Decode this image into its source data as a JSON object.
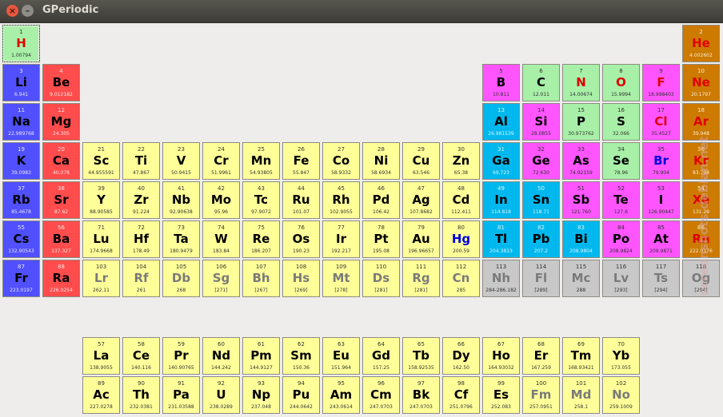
{
  "window": {
    "title": "GPeriodic",
    "close_glyph": "×",
    "minimize_glyph": "–"
  },
  "watermark": "screenshots.debian.net",
  "colors": {
    "h": "#a8f0a8",
    "alkali": "#5050ff",
    "alkaline": "#ff4c4c",
    "transition": "#ffff99",
    "metal": "#00b8ee",
    "metalloid": "#ff55ff",
    "nonmetal": "#a8f0a8",
    "halogen": "#ff55ff",
    "noble": "#cc7a00",
    "lanth": "#ffff99",
    "unknown": "#c8c8c8",
    "gas_symbol": "#e00000",
    "liquid_symbol": "#0000e0",
    "synthetic_symbol": "#7a7a7a"
  },
  "elements": [
    {
      "n": "1",
      "s": "H",
      "m": "1.00794",
      "c": "h",
      "t": "g"
    },
    {
      "n": "2",
      "s": "He",
      "m": "4.002602",
      "c": "noble",
      "t": "g"
    },
    {
      "n": "3",
      "s": "Li",
      "m": "6.941",
      "c": "alkali"
    },
    {
      "n": "4",
      "s": "Be",
      "m": "9.012182",
      "c": "alkaline"
    },
    {
      "n": "5",
      "s": "B",
      "m": "10.811",
      "c": "metalloid"
    },
    {
      "n": "6",
      "s": "C",
      "m": "12.011",
      "c": "nonmetal"
    },
    {
      "n": "7",
      "s": "N",
      "m": "14.00674",
      "c": "nonmetal",
      "t": "g"
    },
    {
      "n": "8",
      "s": "O",
      "m": "15.9994",
      "c": "nonmetal",
      "t": "g"
    },
    {
      "n": "9",
      "s": "F",
      "m": "18.998403",
      "c": "halogen",
      "t": "g"
    },
    {
      "n": "10",
      "s": "Ne",
      "m": "20.1797",
      "c": "noble",
      "t": "g"
    },
    {
      "n": "11",
      "s": "Na",
      "m": "22.989768",
      "c": "alkali"
    },
    {
      "n": "12",
      "s": "Mg",
      "m": "24.305",
      "c": "alkaline"
    },
    {
      "n": "13",
      "s": "Al",
      "m": "26.981539",
      "c": "metal"
    },
    {
      "n": "14",
      "s": "Si",
      "m": "28.0855",
      "c": "metalloid"
    },
    {
      "n": "15",
      "s": "P",
      "m": "30.973762",
      "c": "nonmetal"
    },
    {
      "n": "16",
      "s": "S",
      "m": "32.066",
      "c": "nonmetal"
    },
    {
      "n": "17",
      "s": "Cl",
      "m": "35.4527",
      "c": "halogen",
      "t": "g"
    },
    {
      "n": "18",
      "s": "Ar",
      "m": "39.948",
      "c": "noble",
      "t": "g"
    },
    {
      "n": "19",
      "s": "K",
      "m": "39.0983",
      "c": "alkali"
    },
    {
      "n": "20",
      "s": "Ca",
      "m": "40.078",
      "c": "alkaline"
    },
    {
      "n": "21",
      "s": "Sc",
      "m": "44.955591",
      "c": "transition"
    },
    {
      "n": "22",
      "s": "Ti",
      "m": "47.867",
      "c": "transition"
    },
    {
      "n": "23",
      "s": "V",
      "m": "50.9415",
      "c": "transition"
    },
    {
      "n": "24",
      "s": "Cr",
      "m": "51.9961",
      "c": "transition"
    },
    {
      "n": "25",
      "s": "Mn",
      "m": "54.93805",
      "c": "transition"
    },
    {
      "n": "26",
      "s": "Fe",
      "m": "55.847",
      "c": "transition"
    },
    {
      "n": "27",
      "s": "Co",
      "m": "58.9332",
      "c": "transition"
    },
    {
      "n": "28",
      "s": "Ni",
      "m": "58.6934",
      "c": "transition"
    },
    {
      "n": "29",
      "s": "Cu",
      "m": "63.546",
      "c": "transition"
    },
    {
      "n": "30",
      "s": "Zn",
      "m": "65.38",
      "c": "transition"
    },
    {
      "n": "31",
      "s": "Ga",
      "m": "69.723",
      "c": "metal"
    },
    {
      "n": "32",
      "s": "Ge",
      "m": "72.630",
      "c": "metalloid"
    },
    {
      "n": "33",
      "s": "As",
      "m": "74.92159",
      "c": "metalloid"
    },
    {
      "n": "34",
      "s": "Se",
      "m": "78.96",
      "c": "nonmetal"
    },
    {
      "n": "35",
      "s": "Br",
      "m": "79.904",
      "c": "halogen",
      "t": "l"
    },
    {
      "n": "36",
      "s": "Kr",
      "m": "83.798",
      "c": "noble",
      "t": "g"
    },
    {
      "n": "37",
      "s": "Rb",
      "m": "85.4678",
      "c": "alkali"
    },
    {
      "n": "38",
      "s": "Sr",
      "m": "87.62",
      "c": "alkaline"
    },
    {
      "n": "39",
      "s": "Y",
      "m": "88.90585",
      "c": "transition"
    },
    {
      "n": "40",
      "s": "Zr",
      "m": "91.224",
      "c": "transition"
    },
    {
      "n": "41",
      "s": "Nb",
      "m": "92.90638",
      "c": "transition"
    },
    {
      "n": "42",
      "s": "Mo",
      "m": "95.96",
      "c": "transition"
    },
    {
      "n": "43",
      "s": "Tc",
      "m": "97.9072",
      "c": "transition"
    },
    {
      "n": "44",
      "s": "Ru",
      "m": "101.07",
      "c": "transition"
    },
    {
      "n": "45",
      "s": "Rh",
      "m": "102.9055",
      "c": "transition"
    },
    {
      "n": "46",
      "s": "Pd",
      "m": "106.42",
      "c": "transition"
    },
    {
      "n": "47",
      "s": "Ag",
      "m": "107.8682",
      "c": "transition"
    },
    {
      "n": "48",
      "s": "Cd",
      "m": "112.411",
      "c": "transition"
    },
    {
      "n": "49",
      "s": "In",
      "m": "114.818",
      "c": "metal"
    },
    {
      "n": "50",
      "s": "Sn",
      "m": "118.71",
      "c": "metal"
    },
    {
      "n": "51",
      "s": "Sb",
      "m": "121.760",
      "c": "metalloid"
    },
    {
      "n": "52",
      "s": "Te",
      "m": "127.6",
      "c": "metalloid"
    },
    {
      "n": "53",
      "s": "I",
      "m": "126.90447",
      "c": "halogen"
    },
    {
      "n": "54",
      "s": "Xe",
      "m": "131.29",
      "c": "noble",
      "t": "g"
    },
    {
      "n": "55",
      "s": "Cs",
      "m": "132.90543",
      "c": "alkali"
    },
    {
      "n": "56",
      "s": "Ba",
      "m": "137.327",
      "c": "alkaline"
    },
    {
      "n": "71",
      "s": "Lu",
      "m": "174.9668",
      "c": "transition"
    },
    {
      "n": "72",
      "s": "Hf",
      "m": "178.49",
      "c": "transition"
    },
    {
      "n": "73",
      "s": "Ta",
      "m": "180.9479",
      "c": "transition"
    },
    {
      "n": "74",
      "s": "W",
      "m": "183.84",
      "c": "transition"
    },
    {
      "n": "75",
      "s": "Re",
      "m": "186.207",
      "c": "transition"
    },
    {
      "n": "76",
      "s": "Os",
      "m": "190.23",
      "c": "transition"
    },
    {
      "n": "77",
      "s": "Ir",
      "m": "192.217",
      "c": "transition"
    },
    {
      "n": "78",
      "s": "Pt",
      "m": "195.08",
      "c": "transition"
    },
    {
      "n": "79",
      "s": "Au",
      "m": "196.96657",
      "c": "transition"
    },
    {
      "n": "80",
      "s": "Hg",
      "m": "200.59",
      "c": "transition",
      "t": "l"
    },
    {
      "n": "81",
      "s": "Tl",
      "m": "204.3833",
      "c": "metal"
    },
    {
      "n": "82",
      "s": "Pb",
      "m": "207.2",
      "c": "metal"
    },
    {
      "n": "83",
      "s": "Bi",
      "m": "208.9804",
      "c": "metal"
    },
    {
      "n": "84",
      "s": "Po",
      "m": "208.9824",
      "c": "metalloid"
    },
    {
      "n": "85",
      "s": "At",
      "m": "209.9871",
      "c": "halogen"
    },
    {
      "n": "86",
      "s": "Rn",
      "m": "222.0176",
      "c": "noble",
      "t": "g"
    },
    {
      "n": "87",
      "s": "Fr",
      "m": "223.0197",
      "c": "alkali"
    },
    {
      "n": "88",
      "s": "Ra",
      "m": "226.0254",
      "c": "alkaline"
    },
    {
      "n": "103",
      "s": "Lr",
      "m": "262.11",
      "c": "transition",
      "t": "x"
    },
    {
      "n": "104",
      "s": "Rf",
      "m": "261",
      "c": "transition",
      "t": "x"
    },
    {
      "n": "105",
      "s": "Db",
      "m": "268",
      "c": "transition",
      "t": "x"
    },
    {
      "n": "106",
      "s": "Sg",
      "m": "[271]",
      "c": "transition",
      "t": "x"
    },
    {
      "n": "107",
      "s": "Bh",
      "m": "[267]",
      "c": "transition",
      "t": "x"
    },
    {
      "n": "108",
      "s": "Hs",
      "m": "[269]",
      "c": "transition",
      "t": "x"
    },
    {
      "n": "109",
      "s": "Mt",
      "m": "[278]",
      "c": "transition",
      "t": "x"
    },
    {
      "n": "110",
      "s": "Ds",
      "m": "[281]",
      "c": "transition",
      "t": "x"
    },
    {
      "n": "111",
      "s": "Rg",
      "m": "[281]",
      "c": "transition",
      "t": "x"
    },
    {
      "n": "112",
      "s": "Cn",
      "m": "285",
      "c": "transition",
      "t": "x"
    },
    {
      "n": "113",
      "s": "Nh",
      "m": "284-286.182",
      "c": "unknown",
      "t": "x"
    },
    {
      "n": "114",
      "s": "Fl",
      "m": "[289]",
      "c": "unknown",
      "t": "x"
    },
    {
      "n": "115",
      "s": "Mc",
      "m": "288",
      "c": "unknown",
      "t": "x"
    },
    {
      "n": "116",
      "s": "Lv",
      "m": "[293]",
      "c": "unknown",
      "t": "x"
    },
    {
      "n": "117",
      "s": "Ts",
      "m": "[294]",
      "c": "unknown",
      "t": "x"
    },
    {
      "n": "118",
      "s": "Og",
      "m": "[294]",
      "c": "unknown",
      "t": "x"
    },
    {
      "n": "57",
      "s": "La",
      "m": "138.9055",
      "c": "lanth"
    },
    {
      "n": "58",
      "s": "Ce",
      "m": "140.116",
      "c": "lanth"
    },
    {
      "n": "59",
      "s": "Pr",
      "m": "140.90765",
      "c": "lanth"
    },
    {
      "n": "60",
      "s": "Nd",
      "m": "144.242",
      "c": "lanth"
    },
    {
      "n": "61",
      "s": "Pm",
      "m": "144.9127",
      "c": "lanth"
    },
    {
      "n": "62",
      "s": "Sm",
      "m": "150.36",
      "c": "lanth"
    },
    {
      "n": "63",
      "s": "Eu",
      "m": "151.964",
      "c": "lanth"
    },
    {
      "n": "64",
      "s": "Gd",
      "m": "157.25",
      "c": "lanth"
    },
    {
      "n": "65",
      "s": "Tb",
      "m": "158.92535",
      "c": "lanth"
    },
    {
      "n": "66",
      "s": "Dy",
      "m": "162.50",
      "c": "lanth"
    },
    {
      "n": "67",
      "s": "Ho",
      "m": "164.93032",
      "c": "lanth"
    },
    {
      "n": "68",
      "s": "Er",
      "m": "167.259",
      "c": "lanth"
    },
    {
      "n": "69",
      "s": "Tm",
      "m": "168.93421",
      "c": "lanth"
    },
    {
      "n": "70",
      "s": "Yb",
      "m": "173.055",
      "c": "lanth"
    },
    {
      "n": "89",
      "s": "Ac",
      "m": "227.0278",
      "c": "lanth"
    },
    {
      "n": "90",
      "s": "Th",
      "m": "232.0381",
      "c": "lanth"
    },
    {
      "n": "91",
      "s": "Pa",
      "m": "231.03588",
      "c": "lanth"
    },
    {
      "n": "92",
      "s": "U",
      "m": "238.0289",
      "c": "lanth"
    },
    {
      "n": "93",
      "s": "Np",
      "m": "237.048",
      "c": "lanth"
    },
    {
      "n": "94",
      "s": "Pu",
      "m": "244.0642",
      "c": "lanth"
    },
    {
      "n": "95",
      "s": "Am",
      "m": "243.0614",
      "c": "lanth"
    },
    {
      "n": "96",
      "s": "Cm",
      "m": "247.0703",
      "c": "lanth"
    },
    {
      "n": "97",
      "s": "Bk",
      "m": "247.0703",
      "c": "lanth"
    },
    {
      "n": "98",
      "s": "Cf",
      "m": "251.0796",
      "c": "lanth"
    },
    {
      "n": "99",
      "s": "Es",
      "m": "252.083",
      "c": "lanth"
    },
    {
      "n": "100",
      "s": "Fm",
      "m": "257.0951",
      "c": "lanth",
      "t": "x"
    },
    {
      "n": "101",
      "s": "Md",
      "m": "258.1",
      "c": "lanth",
      "t": "x"
    },
    {
      "n": "102",
      "s": "No",
      "m": "259.1009",
      "c": "lanth",
      "t": "x"
    }
  ]
}
